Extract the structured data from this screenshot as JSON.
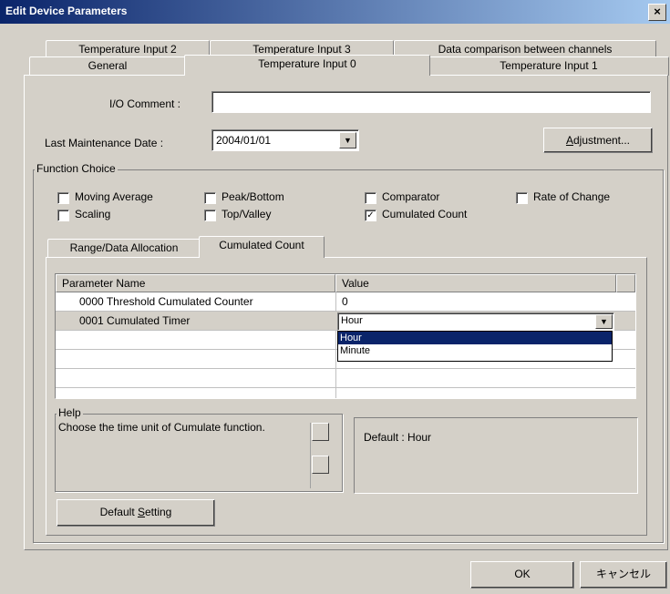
{
  "window": {
    "title": "Edit Device Parameters",
    "close": "×"
  },
  "tabs": {
    "row_top": [
      "Temperature Input 2",
      "Temperature Input 3",
      "Data comparison between channels"
    ],
    "row_bottom": [
      "General",
      "Temperature Input 0",
      "Temperature Input 1"
    ]
  },
  "io_comment": {
    "label": "I/O Comment :",
    "value": ""
  },
  "maintenance": {
    "label": "Last Maintenance Date :",
    "value": "2004/01/01"
  },
  "adjustment_button": {
    "pre": "",
    "key": "A",
    "post": "djustment..."
  },
  "function_choice": {
    "title": "Function Choice",
    "options": [
      {
        "label": "Moving Average",
        "checked": false
      },
      {
        "label": "Peak/Bottom",
        "checked": false
      },
      {
        "label": "Comparator",
        "checked": false
      },
      {
        "label": "Rate of Change",
        "checked": false
      },
      {
        "label": "Scaling",
        "checked": false
      },
      {
        "label": "Top/Valley",
        "checked": false
      },
      {
        "label": "Cumulated Count",
        "checked": true
      }
    ],
    "check_glyph": "✓"
  },
  "inner_tabs": [
    "Range/Data Allocation",
    "Cumulated Count"
  ],
  "param_table": {
    "headers": [
      "Parameter Name",
      "Value"
    ],
    "rows": [
      {
        "name": "0000 Threshold Cumulated Counter",
        "value": "0"
      },
      {
        "name": "0001 Cumulated Timer",
        "value": "Hour"
      }
    ],
    "dropdown_options": [
      "Hour",
      "Minute"
    ],
    "arrow": "▼"
  },
  "help": {
    "title": "Help",
    "text": "Choose the time unit of Cumulate function.",
    "default": "Default : Hour"
  },
  "default_setting_button": {
    "pre": "Default ",
    "key": "S",
    "post": "etting"
  },
  "footer": {
    "ok": "OK",
    "cancel": "キャンセル"
  }
}
